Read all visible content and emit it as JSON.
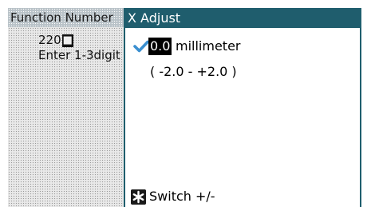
{
  "background_panel": {
    "title": "Function Number",
    "value": "220",
    "cursor_glyph": "■",
    "hint": "Enter 1-3digit"
  },
  "dialog": {
    "title": "X Adjust",
    "value": "0.0",
    "unit": "millimeter",
    "range": "( -2.0 - +2.0 )",
    "switch_label": "Switch +/-"
  },
  "icons": {
    "selected": "checkmark-icon",
    "switch": "asterisk-key-icon"
  },
  "colors": {
    "title_bar": "#1f5d6d",
    "checkmark": "#3a8fd0",
    "value_highlight": "#000000"
  }
}
